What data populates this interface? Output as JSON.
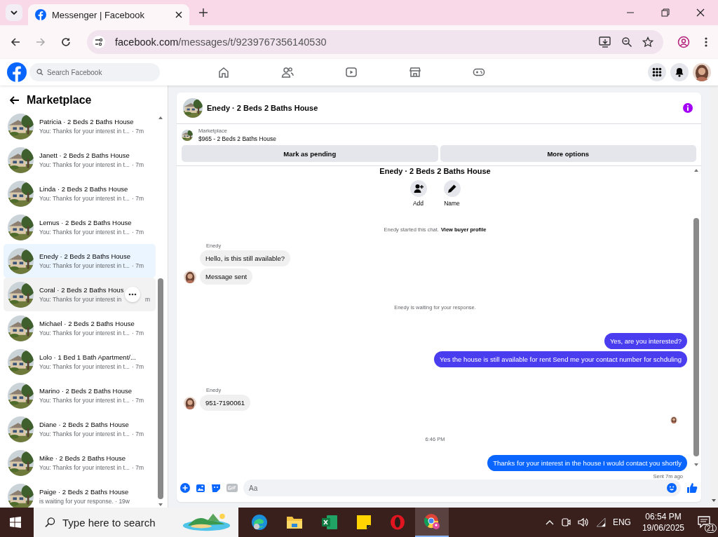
{
  "browser": {
    "tab_title": "Messenger | Facebook",
    "url_host": "facebook.com",
    "url_path": "/messages/t/9239767356140530"
  },
  "facebook_header": {
    "search": {
      "placeholder": "Search Facebook"
    }
  },
  "sidebar": {
    "title": "Marketplace",
    "conversations": [
      {
        "title": "Patricia · 2 Beds 2 Baths House",
        "preview": "You: Thanks for your interest in t...",
        "time": "· 7m",
        "selected": false,
        "hovered": false
      },
      {
        "title": "Janett · 2 Beds 2 Baths House",
        "preview": "You: Thanks for your interest in t...",
        "time": "· 7m",
        "selected": false,
        "hovered": false
      },
      {
        "title": "Linda · 2 Beds 2 Baths House",
        "preview": "You: Thanks for your interest in t...",
        "time": "· 7m",
        "selected": false,
        "hovered": false
      },
      {
        "title": "Lemus · 2 Beds 2 Baths House",
        "preview": "You: Thanks for your interest in t...",
        "time": "· 7m",
        "selected": false,
        "hovered": false
      },
      {
        "title": "Enedy · 2 Beds 2 Baths House",
        "preview": "You: Thanks for your interest in t...",
        "time": "· 7m",
        "selected": true,
        "hovered": false
      },
      {
        "title": "Coral · 2 Beds 2 Baths Hous",
        "preview": "You: Thanks for your interest in",
        "time": "m",
        "selected": false,
        "hovered": true
      },
      {
        "title": "Michael · 2 Beds 2 Baths House",
        "preview": "You: Thanks for your interest in t...",
        "time": "· 7m",
        "selected": false,
        "hovered": false
      },
      {
        "title": "Lolo · 1 Bed 1 Bath Apartment/...",
        "preview": "You: Thanks for your interest in t...",
        "time": "· 7m",
        "selected": false,
        "hovered": false
      },
      {
        "title": "Marino · 2 Beds 2 Baths House",
        "preview": "You: Thanks for your interest in t...",
        "time": "· 7m",
        "selected": false,
        "hovered": false
      },
      {
        "title": "Diane · 2 Beds 2 Baths House",
        "preview": "You: Thanks for your interest in t...",
        "time": "· 7m",
        "selected": false,
        "hovered": false
      },
      {
        "title": "Mike · 2 Beds 2 Baths House",
        "preview": "You: Thanks for your interest in t...",
        "time": "· 7m",
        "selected": false,
        "hovered": false
      },
      {
        "title": "Paige · 2 Beds 2 Baths House",
        "preview": "is waiting for your response. · 19w",
        "selected": false,
        "hovered": false
      }
    ]
  },
  "chat": {
    "title": "Enedy · 2 Beds 2 Baths House",
    "listing": {
      "label": "Marketplace",
      "price_title": "$965 - 2 Beds 2 Baths House",
      "buttons": [
        "Mark as pending",
        "More options"
      ]
    },
    "intro": {
      "title": "Enedy · 2 Beds 2 Baths House",
      "actions": [
        {
          "kind": "add",
          "label": "Add"
        },
        {
          "kind": "name",
          "label": "Name"
        }
      ]
    },
    "messages": [
      {
        "kind": "system",
        "text": "Enedy started this chat.",
        "link": "View buyer profile"
      },
      {
        "kind": "incoming",
        "sender": "Enedy",
        "bubbles": [
          "Hello, is this still available?",
          "Message sent"
        ]
      },
      {
        "kind": "system",
        "text": "Enedy is waiting for your response."
      },
      {
        "kind": "outgoing",
        "color": "#4a3df0",
        "bubbles": [
          "Yes, are you interested?",
          "Yes the house is still available for rent Send me your contact number for schduling"
        ]
      },
      {
        "kind": "incoming",
        "sender": "Enedy",
        "bubbles": [
          "951-7190061"
        ]
      },
      {
        "kind": "seen"
      },
      {
        "kind": "time",
        "text": "6:46 PM"
      },
      {
        "kind": "outgoing",
        "color": "#0a66ff",
        "bubbles": [
          "Thanks for your interest in the house I would contact you shortly"
        ],
        "status": "Sent 7m ago"
      }
    ],
    "composer": {
      "placeholder": "Aa"
    }
  },
  "taskbar": {
    "search_placeholder": "Type here to search",
    "language": "ENG",
    "time": "06:54 PM",
    "date": "19/06/2025",
    "notifications": "21"
  }
}
